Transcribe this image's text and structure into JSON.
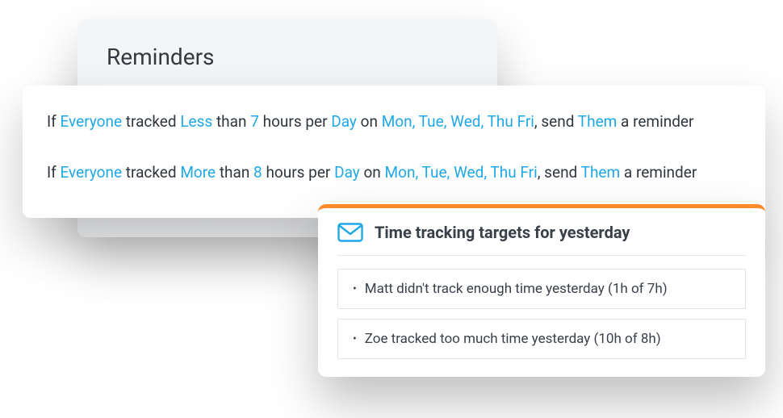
{
  "header": {
    "title": "Reminders"
  },
  "rules": [
    {
      "prefix": "If",
      "who": "Everyone",
      "tracked": "tracked",
      "comparator": "Less",
      "than": "than",
      "hours": "7",
      "hoursSuffix": "hours per",
      "period": "Day",
      "on": "on",
      "days": "Mon, Tue, Wed, Thu Fri",
      "send": ", send",
      "recipient": "Them",
      "suffix": "a reminder"
    },
    {
      "prefix": "If",
      "who": "Everyone",
      "tracked": "tracked",
      "comparator": "More",
      "than": "than",
      "hours": "8",
      "hoursSuffix": "hours per",
      "period": "Day",
      "on": "on",
      "days": "Mon, Tue, Wed, Thu Fri",
      "send": ", send",
      "recipient": "Them",
      "suffix": "a reminder"
    }
  ],
  "targets": {
    "title": "Time tracking targets for yesterday",
    "items": [
      "Matt didn't track enough time yesterday (1h of 7h)",
      "Zoe tracked too much time yesterday (10h of 8h)"
    ]
  }
}
